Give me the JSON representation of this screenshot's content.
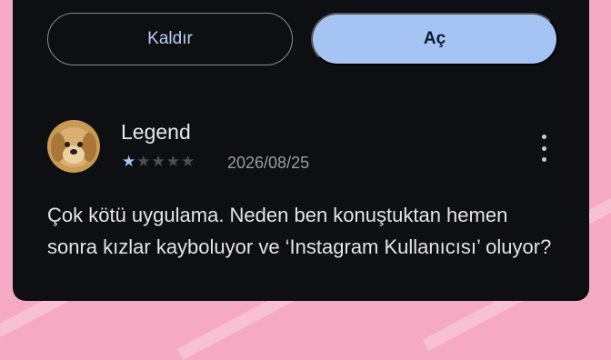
{
  "actions": {
    "remove_label": "Kaldır",
    "open_label": "Aç"
  },
  "review": {
    "author": "Legend",
    "rating": 1,
    "rating_max": 5,
    "date": "2026/08/25",
    "text": "Çok kötü uygulama. Neden ben konuştuktan hemen sonra kızlar kayboluyor ve ‘Instagram Kullanıcısı’ oluyor?",
    "avatar_icon": "dog-avatar-icon",
    "menu_icon": "more-vert-icon"
  },
  "colors": {
    "background_pink": "#f6a9c2",
    "card": "#0e0f12",
    "accent": "#a6c4f3",
    "star_on": "#a6c4f3",
    "star_off": "#4d5058"
  }
}
